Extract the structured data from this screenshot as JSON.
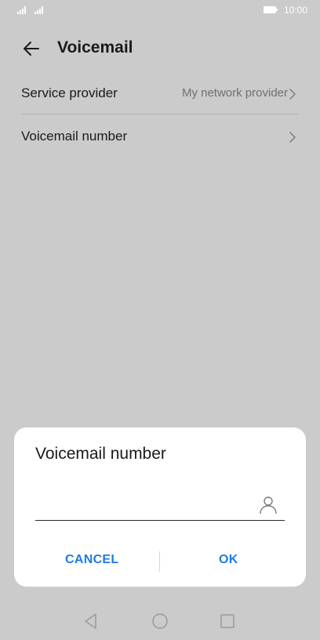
{
  "status_bar": {
    "time": "10:00"
  },
  "header": {
    "title": "Voicemail"
  },
  "settings": {
    "service_provider_label": "Service provider",
    "service_provider_value": "My network provider",
    "voicemail_number_label": "Voicemail number"
  },
  "dialog": {
    "title": "Voicemail number",
    "input_value": "",
    "cancel_label": "CANCEL",
    "ok_label": "OK"
  },
  "colors": {
    "accent": "#1e7be0",
    "background": "#cbcbcb",
    "dialog": "#ffffff"
  },
  "icons": {
    "back": "arrow-left-icon",
    "chevron": "chevron-right-icon",
    "contact": "person-icon",
    "nav_back": "triangle-back-icon",
    "nav_home": "circle-home-icon",
    "nav_recents": "square-recents-icon"
  }
}
